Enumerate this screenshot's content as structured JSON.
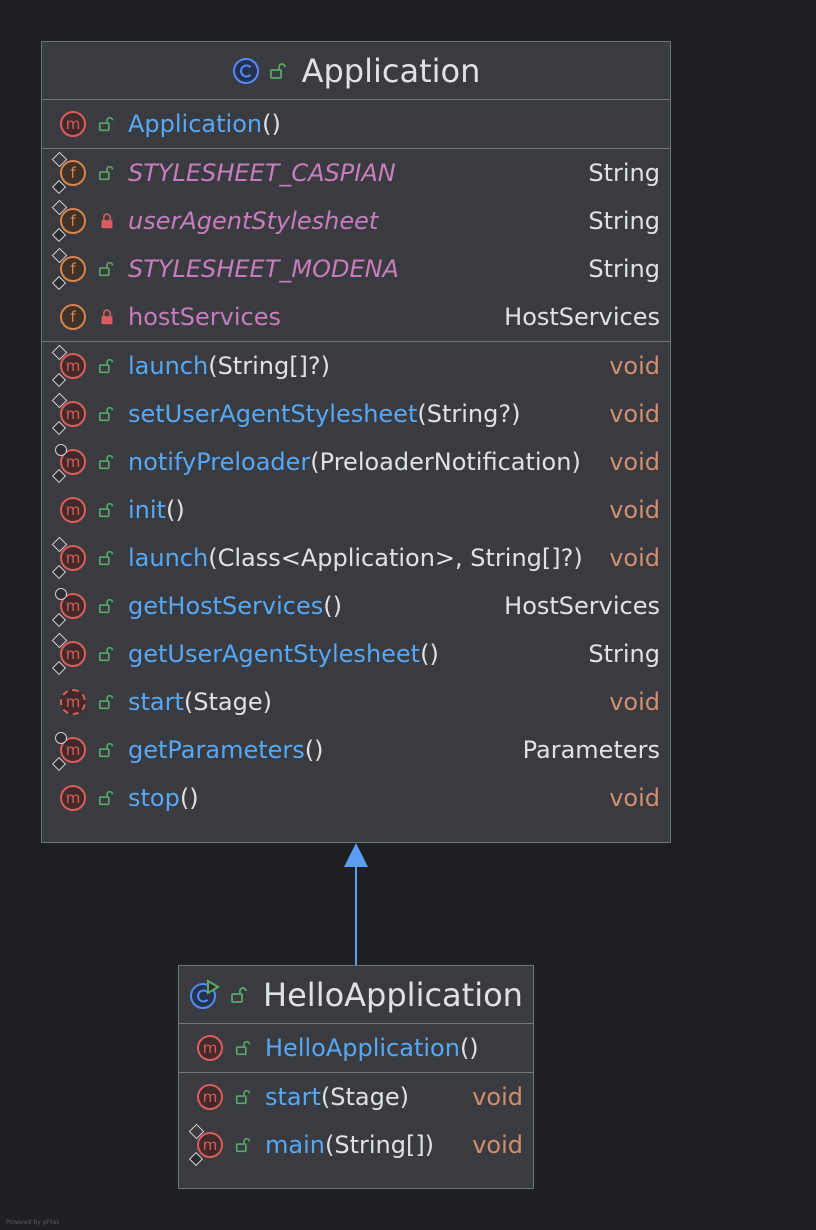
{
  "colors": {
    "background": "#1e1f22",
    "box": "#393b40",
    "border": "#6f737a",
    "method": "#56a8f5",
    "field": "#c77dbb",
    "void": "#cf8e6d",
    "text": "#dfe1e5",
    "arrow": "#5b9df5",
    "public": "#59a869",
    "private": "#db5c5c"
  },
  "classes": [
    {
      "name": "Application",
      "class_icon": "class-icon",
      "constructors": [
        {
          "name": "Application",
          "params": "()",
          "icon": "method-icon",
          "visibility": "public"
        }
      ],
      "fields": [
        {
          "name": "STYLESHEET_CASPIAN",
          "type": "String",
          "icon": "field-icon",
          "visibility": "public",
          "static": true
        },
        {
          "name": "userAgentStylesheet",
          "type": "String",
          "icon": "field-icon",
          "visibility": "private",
          "static": true
        },
        {
          "name": "STYLESHEET_MODENA",
          "type": "String",
          "icon": "field-icon",
          "visibility": "public",
          "static": true
        },
        {
          "name": "hostServices",
          "type": "HostServices",
          "icon": "field-icon",
          "visibility": "private",
          "static": false
        }
      ],
      "methods": [
        {
          "name": "launch",
          "params": "(String[]?)",
          "ret": "void",
          "icon": "method-icon",
          "visibility": "public",
          "overlay": "static"
        },
        {
          "name": "setUserAgentStylesheet",
          "params": "(String?)",
          "ret": "void",
          "icon": "method-icon",
          "visibility": "public",
          "overlay": "static"
        },
        {
          "name": "notifyPreloader",
          "params": "(PreloaderNotification)",
          "ret": "void",
          "icon": "method-icon",
          "visibility": "public",
          "overlay": "final"
        },
        {
          "name": "init",
          "params": "()",
          "ret": "void",
          "icon": "method-icon",
          "visibility": "public",
          "overlay": ""
        },
        {
          "name": "launch",
          "params": "(Class<Application>, String[]?)",
          "ret": "void",
          "icon": "method-icon",
          "visibility": "public",
          "overlay": "static"
        },
        {
          "name": "getHostServices",
          "params": "()",
          "ret": "HostServices",
          "icon": "method-icon",
          "visibility": "public",
          "overlay": "final"
        },
        {
          "name": "getUserAgentStylesheet",
          "params": "()",
          "ret": "String",
          "icon": "method-icon",
          "visibility": "public",
          "overlay": "static"
        },
        {
          "name": "start",
          "params": "(Stage)",
          "ret": "void",
          "icon": "abstract-method-icon",
          "visibility": "public",
          "overlay": ""
        },
        {
          "name": "getParameters",
          "params": "()",
          "ret": "Parameters",
          "icon": "method-icon",
          "visibility": "public",
          "overlay": "final"
        },
        {
          "name": "stop",
          "params": "()",
          "ret": "void",
          "icon": "method-icon",
          "visibility": "public",
          "overlay": ""
        }
      ]
    },
    {
      "name": "HelloApplication",
      "class_icon": "runnable-class-icon",
      "constructors": [
        {
          "name": "HelloApplication",
          "params": "()",
          "icon": "method-icon",
          "visibility": "public"
        }
      ],
      "methods": [
        {
          "name": "start",
          "params": "(Stage)",
          "ret": "void",
          "icon": "method-icon",
          "visibility": "public",
          "overlay": ""
        },
        {
          "name": "main",
          "params": "(String[])",
          "ret": "void",
          "icon": "method-icon",
          "visibility": "public",
          "overlay": "static"
        }
      ]
    }
  ],
  "relation": {
    "type": "inheritance",
    "from": "HelloApplication",
    "to": "Application"
  },
  "footer": "Powered by yFiles"
}
